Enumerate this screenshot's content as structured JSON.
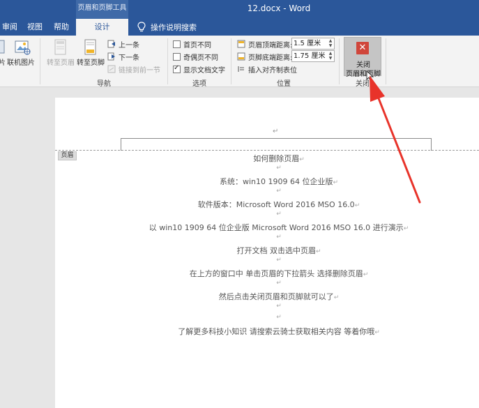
{
  "title_bar": {
    "contextual_group": "页眉和页脚工具",
    "doc_title": "12.docx  -  Word"
  },
  "tabs": {
    "review": "审阅",
    "view": "视图",
    "help": "帮助",
    "design": "设计",
    "tell_me": "操作说明搜索"
  },
  "ribbon": {
    "insert_group": {
      "cut_label": "片",
      "online_pictures": "联机图片"
    },
    "navigation": {
      "label": "导航",
      "goto_header": "转至页眉",
      "goto_footer": "转至页脚",
      "previous": "上一条",
      "next": "下一条",
      "link_previous": "链接到前一节"
    },
    "options": {
      "label": "选项",
      "different_first": "首页不同",
      "different_odd_even": "奇偶页不同",
      "show_doc_text": "显示文档文字"
    },
    "position": {
      "label": "位置",
      "header_top": "页眉顶端距离:",
      "header_top_value": "1.5 厘米",
      "footer_bottom": "页脚底端距离:",
      "footer_bottom_value": "1.75 厘米",
      "insert_align_tab": "插入对齐制表位"
    },
    "close": {
      "label": "关闭",
      "button_line1": "关闭",
      "button_line2": "页眉和页脚"
    }
  },
  "document": {
    "header_tag": "页眉",
    "lines": [
      "如何删除页眉",
      "系统：win10 1909 64 位企业版",
      "软件版本：Microsoft Word 2016 MSO 16.0",
      "以 win10 1909 64 位企业版   Microsoft Word 2016 MSO 16.0 进行演示",
      "打开文档   双击选中页眉",
      "在上方的窗口中   单击页眉的下拉箭头   选择删除页眉",
      "然后点击关闭页眉和页脚就可以了",
      "了解更多科技小知识   请搜索云骑士获取相关内容   等着你哦"
    ]
  },
  "colors": {
    "title_bar": "#2b579a",
    "close_icon": "#d0463b",
    "annotation_arrow": "#e8332a"
  }
}
